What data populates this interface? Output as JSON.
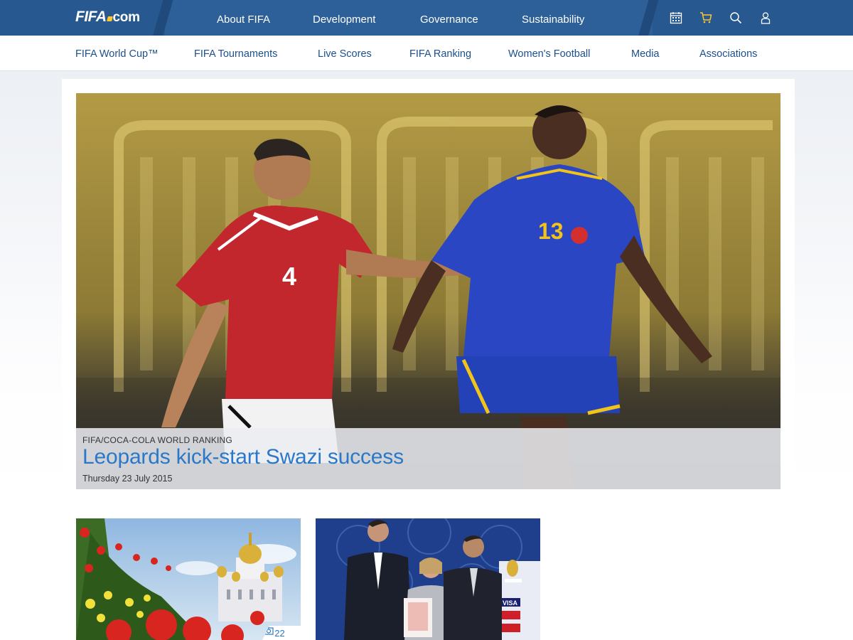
{
  "brand": {
    "logo_main": "FIFA",
    "logo_suffix": "com",
    "accent": "#ffc72c",
    "bar_color": "#2d6099"
  },
  "main_nav": [
    {
      "label": "About FIFA"
    },
    {
      "label": "Development"
    },
    {
      "label": "Governance"
    },
    {
      "label": "Sustainability"
    }
  ],
  "tool_icons": [
    {
      "icon": "calendar-icon"
    },
    {
      "icon": "cart-icon"
    },
    {
      "icon": "search-icon"
    },
    {
      "icon": "user-icon"
    }
  ],
  "sub_nav": [
    {
      "label": "FIFA World Cup™"
    },
    {
      "label": "FIFA Tournaments"
    },
    {
      "label": "Live Scores"
    },
    {
      "label": "FIFA Ranking"
    },
    {
      "label": "Women's Football"
    },
    {
      "label": "Media"
    },
    {
      "label": "Associations"
    }
  ],
  "hero": {
    "kicker": "FIFA/COCA-COLA WORLD RANKING",
    "headline": "Leopards kick-start Swazi success",
    "date": "Thursday 23 July 2015",
    "player_left_number": "4",
    "player_right_number": "13"
  },
  "thumbnails": [
    {
      "photo_count": "22",
      "icon": "camera-icon"
    },
    {
      "badge_lines": [
        "VISA"
      ]
    }
  ]
}
